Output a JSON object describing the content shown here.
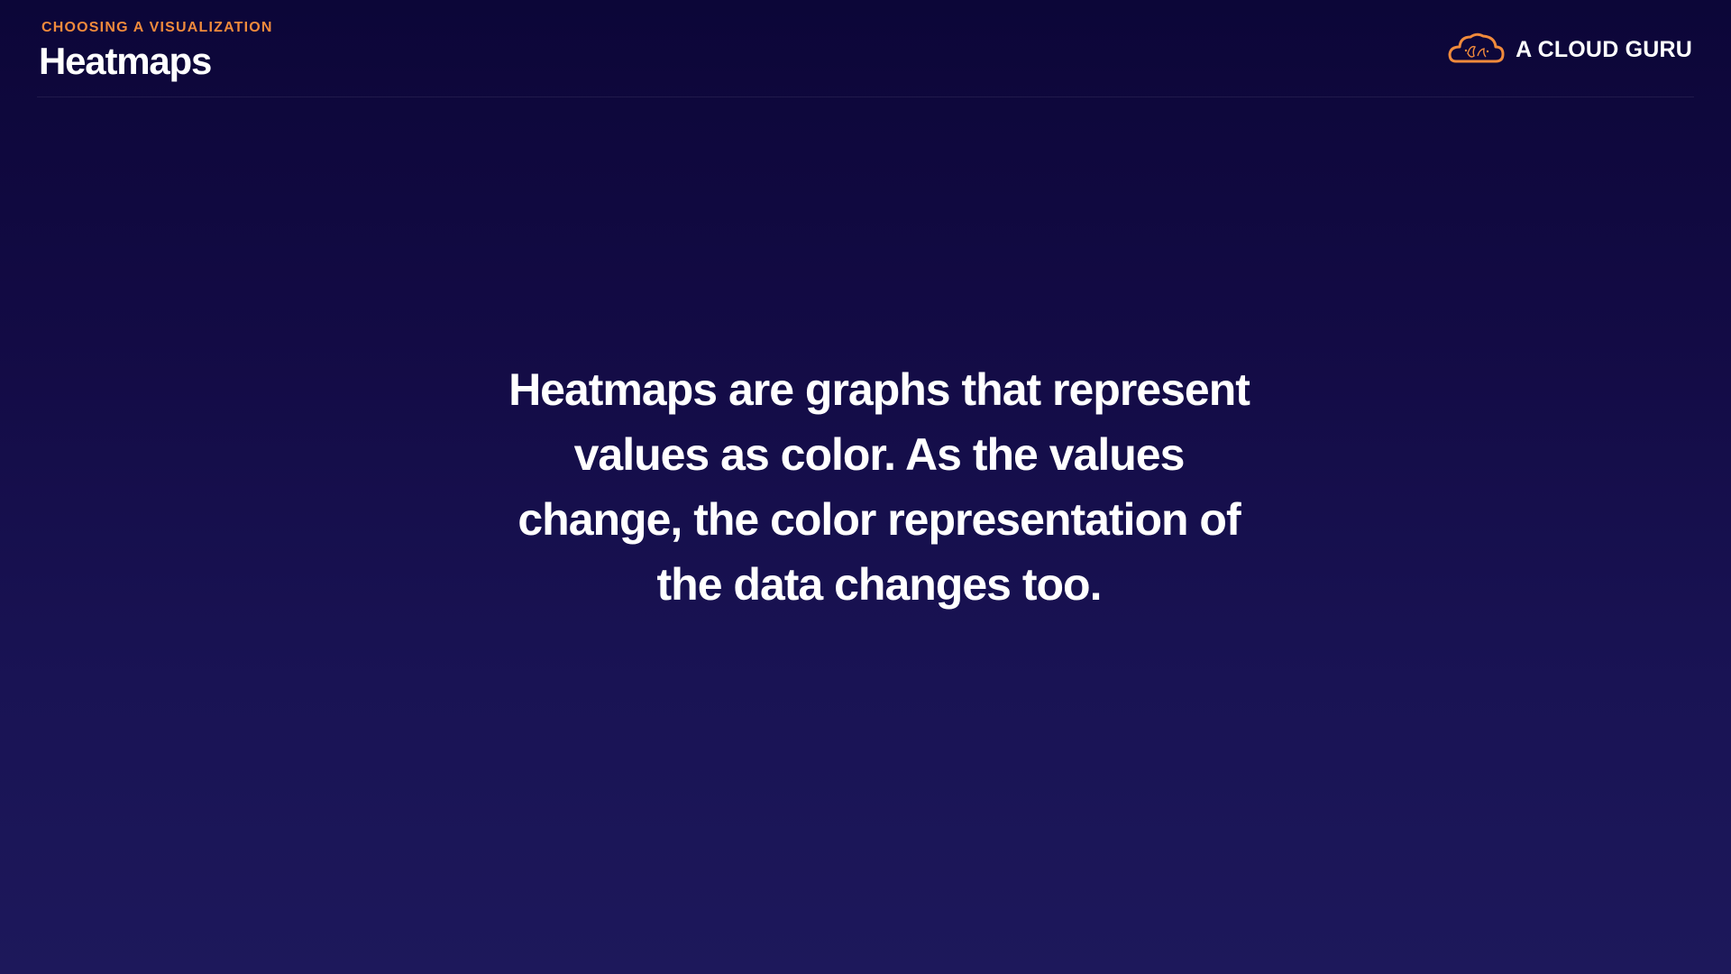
{
  "header": {
    "eyebrow": "CHOOSING A VISUALIZATION",
    "title": "Heatmaps"
  },
  "brand": {
    "name": "A CLOUD GURU",
    "icon": "cloud-logo-icon",
    "accent_color": "#f08a3c"
  },
  "main": {
    "lines": [
      "Heatmaps are graphs that represent",
      "values as color. As the values",
      "change, the color representation of",
      "the data changes too."
    ]
  },
  "colors": {
    "background_top": "#0c0638",
    "background_bottom": "#1d185b",
    "text": "#ffffff",
    "accent": "#f08a3c"
  }
}
